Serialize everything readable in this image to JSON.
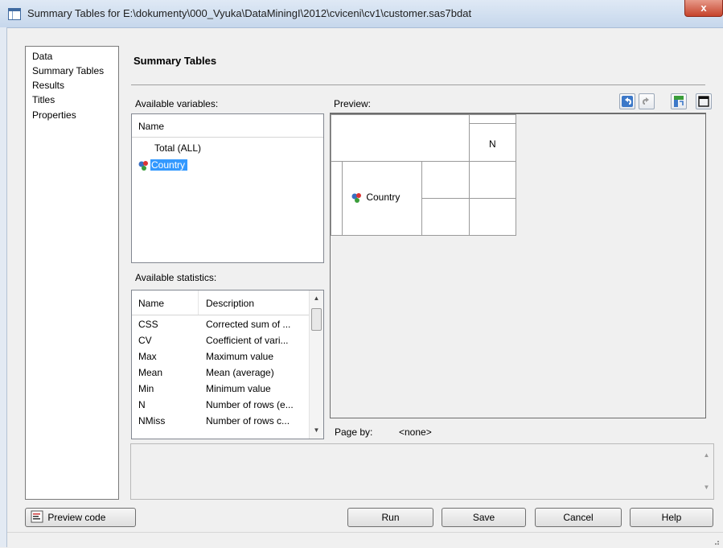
{
  "window": {
    "title": "Summary Tables for E:\\dokumenty\\000_Vyuka\\DataMiningI\\2012\\cviceni\\cv1\\customer.sas7bdat",
    "close_glyph": "x"
  },
  "nav": {
    "items": [
      {
        "label": "Data"
      },
      {
        "label": "Summary Tables"
      },
      {
        "label": "Results"
      },
      {
        "label": "Titles"
      },
      {
        "label": "Properties"
      }
    ]
  },
  "main": {
    "section_title": "Summary Tables",
    "available_variables_label": "Available variables:",
    "variables_header": "Name",
    "variables": [
      {
        "name": "Total (ALL)"
      },
      {
        "name": "Country",
        "selected": true
      }
    ],
    "available_statistics_label": "Available statistics:",
    "stats_columns": [
      "Name",
      "Description"
    ],
    "statistics": [
      {
        "name": "CSS",
        "description": "Corrected sum of ..."
      },
      {
        "name": "CV",
        "description": "Coefficient of vari..."
      },
      {
        "name": "Max",
        "description": "Maximum value"
      },
      {
        "name": "Mean",
        "description": "Mean (average)"
      },
      {
        "name": "Min",
        "description": "Minimum value"
      },
      {
        "name": "N",
        "description": "Number of rows (e..."
      },
      {
        "name": "NMiss",
        "description": "Number of rows c..."
      }
    ],
    "preview_label": "Preview:",
    "preview": {
      "column_stat": "N",
      "row_variable": "Country"
    },
    "page_by_label": "Page by:",
    "page_by_value": "<none>"
  },
  "buttons": {
    "preview_code": "Preview code",
    "run": "Run",
    "save": "Save",
    "cancel": "Cancel",
    "help": "Help"
  },
  "icons": {
    "undo": "undo-icon",
    "redo": "redo-icon",
    "swap": "pivot-icon",
    "maximize": "maximize-icon",
    "variable": "category-variable-icon"
  },
  "colors": {
    "selection": "#3399ff",
    "close_button": "#c6432b"
  }
}
